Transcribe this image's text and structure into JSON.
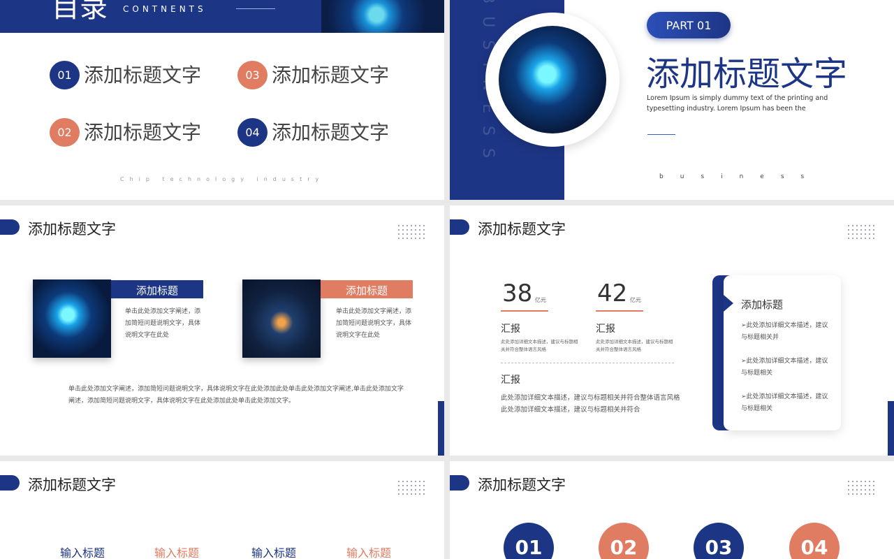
{
  "slide1": {
    "title_cn": "目录",
    "title_en": "CONTNENTS",
    "items": [
      {
        "num": "01",
        "text": "添加标题文字"
      },
      {
        "num": "02",
        "text": "添加标题文字"
      },
      {
        "num": "03",
        "text": "添加标题文字"
      },
      {
        "num": "04",
        "text": "添加标题文字"
      }
    ],
    "footer": "Chip technology industry"
  },
  "slide2": {
    "vertical_text": "BUSINESS",
    "badge": "PART 01",
    "heading": "添加标题文字",
    "body": "Lorem Ipsum is simply dummy text of the printing and typesetting industry. Lorem Ipsum has been the",
    "footer": "business"
  },
  "slide3": {
    "title": "添加标题文字",
    "card1": {
      "label": "添加标题",
      "text": "单击此处添加文字阐述，添加简短问题说明文字，具体说明文字在此处"
    },
    "card2": {
      "label": "添加标题",
      "text": "单击此处添加文字阐述，添加简短问题说明文字，具体说明文字在此处"
    },
    "paragraph": "单击此处添加文字阐述，添加简短问题说明文字，具体说明文字在此处添加此处单击此处添加文字阐述,单击此处添加文字阐述，添加简短问题说明文字，具体说明文字在此处添加此处单击此处添加文字。"
  },
  "slide4": {
    "title": "添加标题文字",
    "stats": [
      {
        "value": "38",
        "unit": "亿元",
        "label": "汇报",
        "desc": "此处添加详细文本描述，建议与标题相关并符合整体语言风格"
      },
      {
        "value": "42",
        "unit": "亿元",
        "label": "汇报",
        "desc": "此处添加详细文本描述，建议与标题相关并符合整体语言风格"
      }
    ],
    "summary_label": "汇报",
    "summary_text": "此处添加详细文本描述，建议与标题相关并符合整体语言风格此处添加详细文本描述，建议与标题相关并符合",
    "panel_title": "添加标题",
    "panel_items": [
      "此处添加详细文本描述，建议与标题相关并",
      "此处添加详细文本描述，建议与标题相关",
      "此处添加详细文本描述，建议与标题相关"
    ]
  },
  "slide5": {
    "title": "添加标题文字",
    "labels": [
      "输入标题",
      "输入标题",
      "输入标题",
      "输入标题"
    ]
  },
  "slide6": {
    "title": "添加标题文字",
    "nums": [
      "01",
      "02",
      "03",
      "04"
    ]
  }
}
